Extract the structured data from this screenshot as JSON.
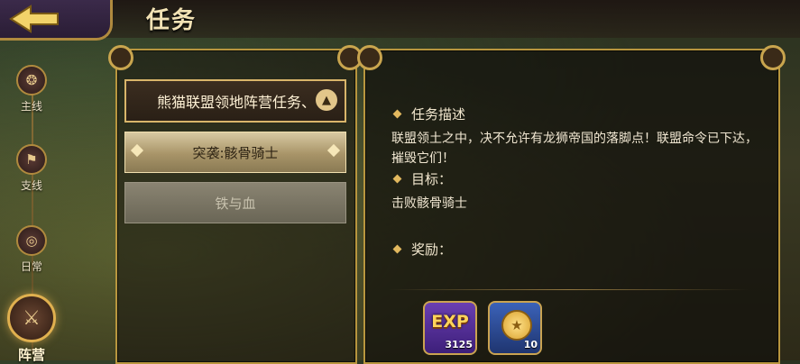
{
  "header": {
    "title": "任务",
    "back_icon": "back-arrow-icon"
  },
  "sidenav": {
    "items": [
      {
        "label": "主线",
        "icon": "scroll-icon",
        "active": false
      },
      {
        "label": "支线",
        "icon": "banner-icon",
        "active": false
      },
      {
        "label": "日常",
        "icon": "spiral-icon",
        "active": false
      },
      {
        "label": "阵营",
        "icon": "crossed-swords-icon",
        "active": true
      }
    ]
  },
  "quest_list": {
    "header": "熊猫联盟领地阵营任务、",
    "items": [
      {
        "label": "突袭:骸骨骑士",
        "state": "selected"
      },
      {
        "label": "铁与血",
        "state": "disabled"
      }
    ]
  },
  "detail": {
    "description_title": "任务描述",
    "description_text": "联盟领土之中，决不允许有龙狮帝国的落脚点！联盟命令已下达，摧毁它们！",
    "objective_title": "目标：",
    "objective_text": "击败骸骨骑士",
    "reward_title": "奖励：",
    "rewards": [
      {
        "label": "EXP",
        "count": "3125",
        "color": "#5a33a0"
      },
      {
        "label": "coin-medal-icon",
        "count": "10",
        "color": "#2d4c98"
      }
    ]
  },
  "colors": {
    "gold_border": "#b8963e",
    "accent": "#e2b85e"
  }
}
